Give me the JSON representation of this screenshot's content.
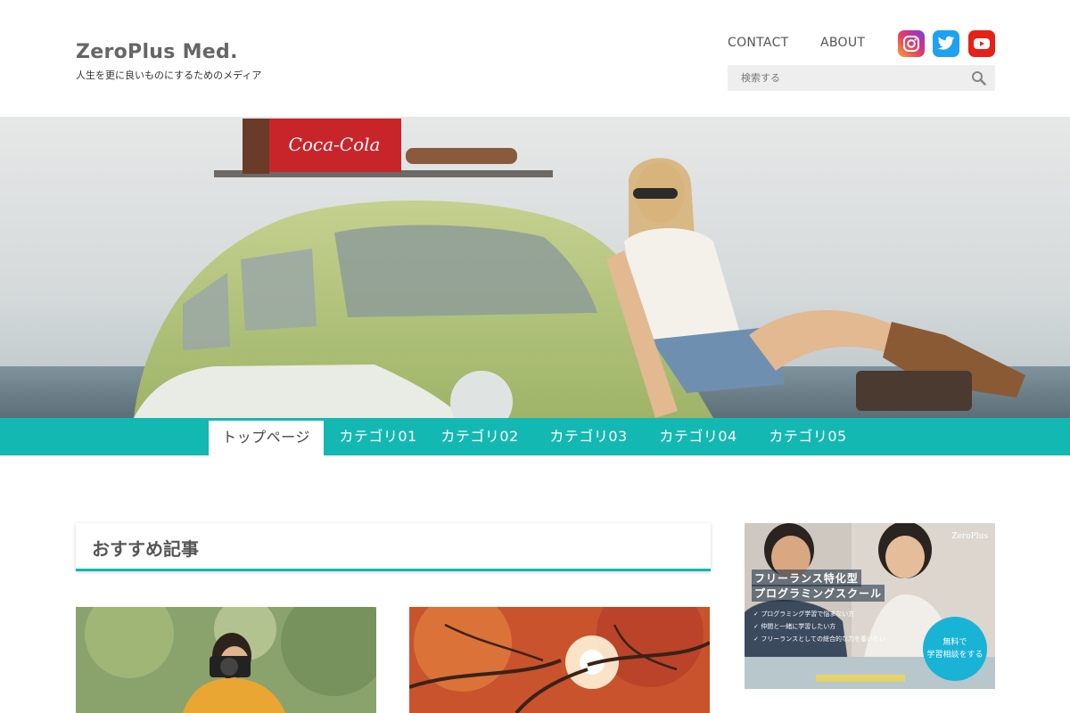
{
  "site": {
    "logo": "ZeroPlus Med.",
    "tagline": "人生を更に良いものにするためのメディア"
  },
  "header_nav": {
    "contact": "CONTACT",
    "about": "ABOUT"
  },
  "social": [
    "instagram-icon",
    "twitter-icon",
    "youtube-icon"
  ],
  "search": {
    "placeholder": "検索する",
    "icon": "search-icon"
  },
  "category_nav": {
    "items": [
      {
        "label": "トップページ",
        "active": true
      },
      {
        "label": "カテゴリ01",
        "active": false
      },
      {
        "label": "カテゴリ02",
        "active": false
      },
      {
        "label": "カテゴリ03",
        "active": false
      },
      {
        "label": "カテゴリ04",
        "active": false
      },
      {
        "label": "カテゴリ05",
        "active": false
      }
    ]
  },
  "main": {
    "section_title": "おすすめ記事"
  },
  "sidebar": {
    "banner": {
      "brand": "ZeroPlus",
      "title_line1": "フリーランス特化型",
      "title_line2": "プログラミングスクール",
      "points": [
        "プログラミング学習で悩まない方",
        "仲間と一緒に学習したい方",
        "フリーランスとしての総合的な力を養いたい"
      ],
      "cta_line1": "無料で",
      "cta_line2": "学習相談をする"
    }
  },
  "colors": {
    "accent": "#14b8b2",
    "logo_text": "#666666",
    "search_bg": "#eeeeee",
    "cta": "#19b3d6"
  }
}
